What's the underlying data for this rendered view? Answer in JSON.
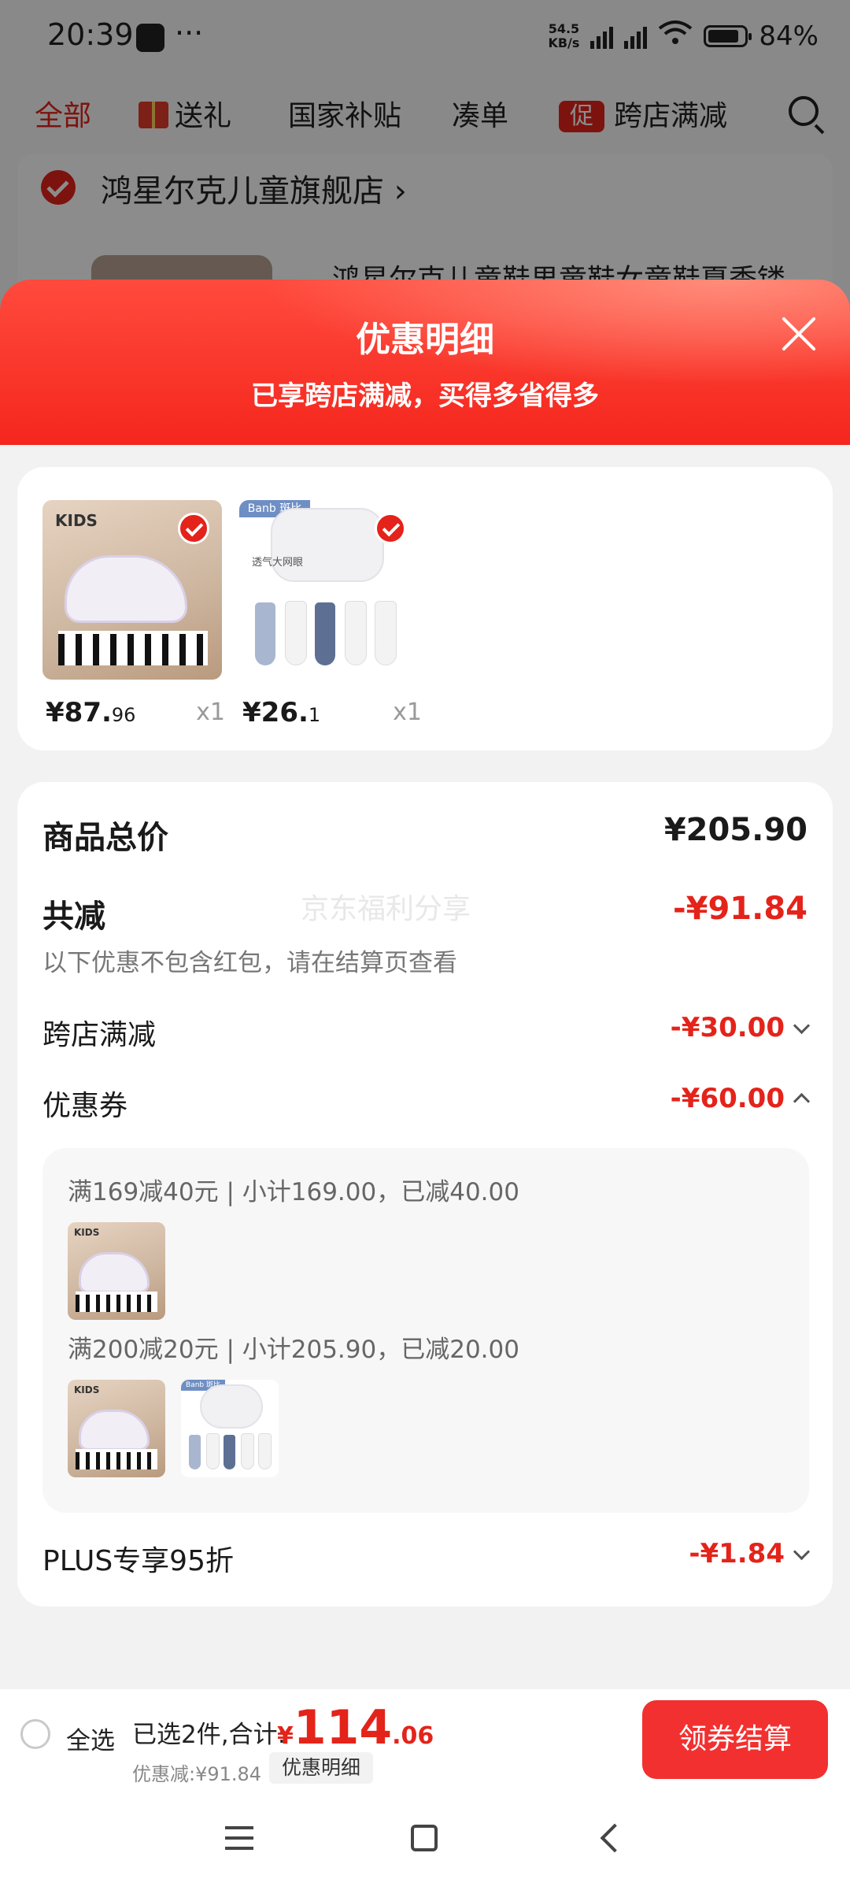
{
  "status_bar": {
    "time": "20:39",
    "dots": "···",
    "net_speed": "54.5",
    "net_unit": "KB/s",
    "battery": "84%"
  },
  "background": {
    "tabs": [
      "全部",
      "送礼",
      "国家补贴",
      "凑单",
      "跨店满减"
    ],
    "promo_badge": "促",
    "store_name": "鸿星尔克儿童旗舰店",
    "store_arrow": "›",
    "product_title": "鸿星尔克儿童鞋男童鞋女童鞋夏季镂"
  },
  "sheet": {
    "title": "优惠明细",
    "subtitle": "已享跨店满减，买得多省得多"
  },
  "items": [
    {
      "logo": "KIDS",
      "price_int": "¥87.",
      "price_dec": "96",
      "qty": "x1"
    },
    {
      "tag": "Banb 斑比",
      "label": "透气大网眼",
      "price_int": "¥26.",
      "price_dec": "1",
      "qty": "x1"
    }
  ],
  "summary": {
    "total_label": "商品总价",
    "total_value": "¥205.90",
    "reduce_label": "共减",
    "reduce_value": "-¥91.84",
    "watermark": "京东福利分享",
    "note": "以下优惠不包含红包，请在结算页查看",
    "cross_store_label": "跨店满减",
    "cross_store_value": "-¥30.00",
    "coupon_label": "优惠券",
    "coupon_value": "-¥60.00",
    "coupons": [
      {
        "text": "满169减40元 | 小计169.00，已减40.00"
      },
      {
        "text": "满200减20元 | 小计205.90，已减20.00"
      }
    ],
    "plus_label": "PLUS专享95折",
    "plus_value": "-¥1.84"
  },
  "checkout": {
    "select_all": "全选",
    "selected_text": "已选2件,合计:",
    "currency": "¥",
    "total_int": "114",
    "total_dec": ".06",
    "discount_text": "优惠减:¥91.84",
    "detail_chip": "优惠明细",
    "button": "领券结算"
  },
  "colors": {
    "accent": "#e4231a",
    "header_gradient_top": "#ff4a3d",
    "button": "#f23030"
  }
}
